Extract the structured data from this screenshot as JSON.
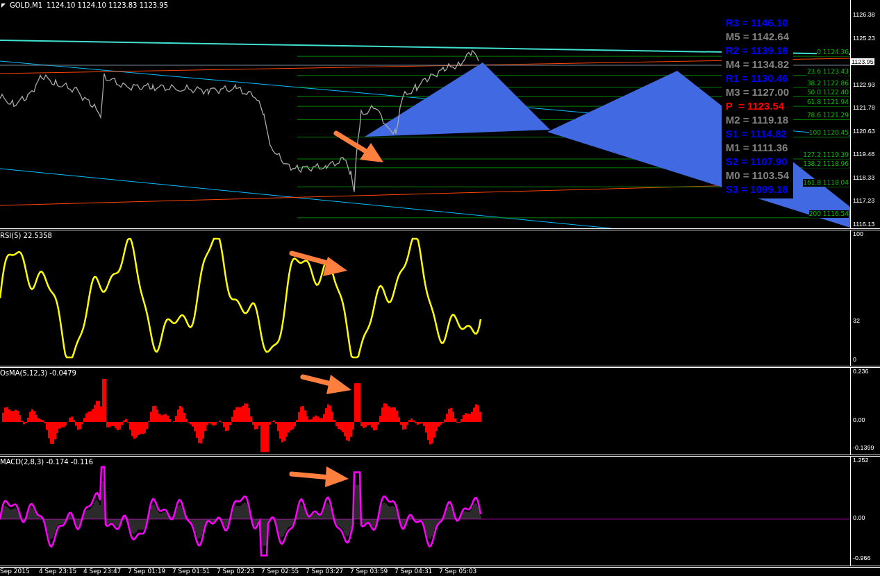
{
  "header": {
    "symbol": "GOLD,M1",
    "quote": "1124.10 1124.10 1123.83 1123.95"
  },
  "pivots": [
    {
      "label": "R3 = 1146.10",
      "color": "#0000ff"
    },
    {
      "label": "M5 = 1142.64",
      "color": "#808080"
    },
    {
      "label": "R2 = 1139.18",
      "color": "#0000ff"
    },
    {
      "label": "M4 = 1134.82",
      "color": "#808080"
    },
    {
      "label": "R1 = 1130.46",
      "color": "#0000ff"
    },
    {
      "label": "M3 = 1127.00",
      "color": "#808080"
    },
    {
      "label": "P  = 1123.54",
      "color": "#ff0000"
    },
    {
      "label": "M2 = 1119.18",
      "color": "#808080"
    },
    {
      "label": "S1 = 1114.82",
      "color": "#0000ff"
    },
    {
      "label": "M1 = 1111.36",
      "color": "#808080"
    },
    {
      "label": "S2 = 1107.90",
      "color": "#0000ff"
    },
    {
      "label": "M0 = 1103.54",
      "color": "#808080"
    },
    {
      "label": "S3 = 1099.18",
      "color": "#0000ff"
    }
  ],
  "fib_levels": [
    "0 1124.36",
    "23.6 1123.43",
    "38.2 1122.86",
    "50.0 1122.40",
    "61.8 1121.94",
    "78.6 1121.29",
    "100 1120.45",
    "127.2 1119.39",
    "138.2 1118.96",
    "161.8 1118.04",
    "200 1116.54"
  ],
  "price_axis": {
    "ticks": [
      "1126.38",
      "1125.23",
      "1122.93",
      "1121.78",
      "1120.63",
      "1119.48",
      "1118.33",
      "1117.23",
      "1116.13"
    ],
    "current_price": "1123.95"
  },
  "indicators": [
    {
      "kind": "rsi",
      "title": "RSI(5) 22.5358",
      "axis": [
        "100",
        "32",
        "0"
      ]
    },
    {
      "kind": "osma",
      "title": "OsMA(5,12,3) -0.0479",
      "axis": [
        "0.236",
        "0.00",
        "-0.1399"
      ]
    },
    {
      "kind": "macd",
      "title": "MACD(2,8,3) -0.174 -0.116",
      "axis": [
        "1.252",
        "0.00",
        "-0.966"
      ]
    }
  ],
  "time_axis": [
    "Sep 2015",
    "4 Sep 23:15",
    "4 Sep 23:47",
    "7 Sep 01:19",
    "7 Sep 01:51",
    "7 Sep 02:23",
    "7 Sep 02:55",
    "7 Sep 03:27",
    "7 Sep 03:59",
    "7 Sep 04:31",
    "7 Sep 05:03"
  ]
}
